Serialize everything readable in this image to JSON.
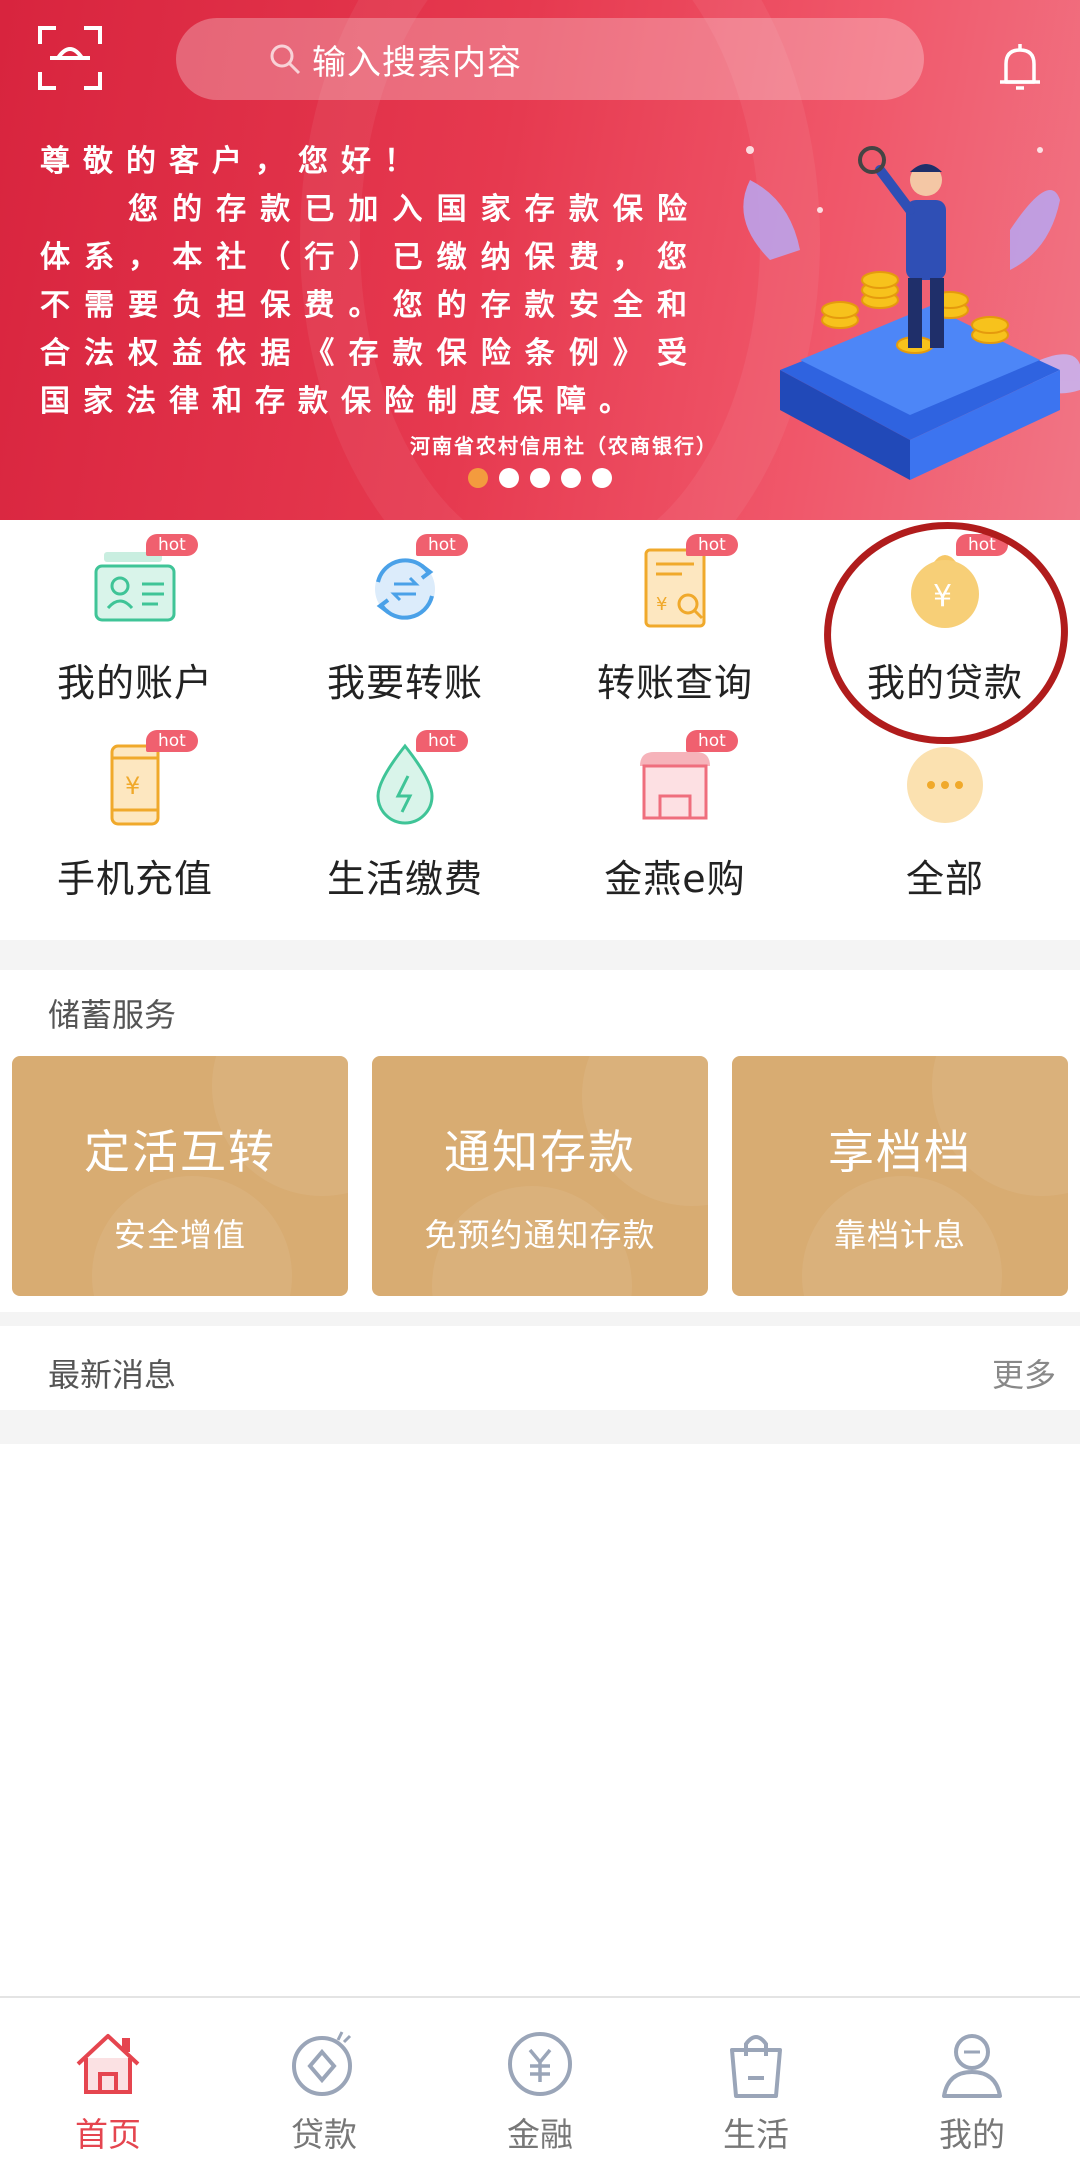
{
  "search": {
    "placeholder": "输入搜索内容"
  },
  "banner": {
    "greeting": "尊敬的客户，您好！",
    "body": "您的存款已加入国家存款保险体系，本社（行）已缴纳保费，您不需要负担保费。您的存款安全和合法权益依据《存款保险条例》受国家法律和存款保险制度保障。",
    "signature": "河南省农村信用社（农商银行）",
    "pages": 5,
    "active_page": 1
  },
  "quick_actions": [
    {
      "label": "我的账户",
      "icon": "id-card-icon",
      "badge": "hot"
    },
    {
      "label": "我要转账",
      "icon": "transfer-icon",
      "badge": "hot"
    },
    {
      "label": "转账查询",
      "icon": "receipt-search-icon",
      "badge": "hot"
    },
    {
      "label": "我的贷款",
      "icon": "money-bag-icon",
      "badge": "hot"
    },
    {
      "label": "手机充值",
      "icon": "phone-recharge-icon",
      "badge": "hot"
    },
    {
      "label": "生活缴费",
      "icon": "water-drop-icon",
      "badge": "hot"
    },
    {
      "label": "金燕e购",
      "icon": "shop-icon",
      "badge": "hot"
    },
    {
      "label": "全部",
      "icon": "more-dots-icon",
      "badge": ""
    }
  ],
  "savings": {
    "title": "储蓄服务",
    "cards": [
      {
        "title": "定活互转",
        "subtitle": "安全增值"
      },
      {
        "title": "通知存款",
        "subtitle": "免预约通知存款"
      },
      {
        "title": "享档档",
        "subtitle": "靠档计息"
      }
    ]
  },
  "news": {
    "title": "最新消息",
    "more": "更多"
  },
  "tabbar": {
    "active": "首页",
    "items": [
      {
        "label": "首页",
        "icon": "home-icon"
      },
      {
        "label": "贷款",
        "icon": "loan-icon"
      },
      {
        "label": "金融",
        "icon": "finance-yen-icon"
      },
      {
        "label": "生活",
        "icon": "shopping-bag-icon"
      },
      {
        "label": "我的",
        "icon": "user-icon"
      }
    ]
  },
  "colors": {
    "brand_red": "#e5454f",
    "banner_start": "#d8243e",
    "card_gold": "#d8ac72",
    "hot_badge": "#f0606f",
    "annotation_circle": "#b01c1c"
  }
}
